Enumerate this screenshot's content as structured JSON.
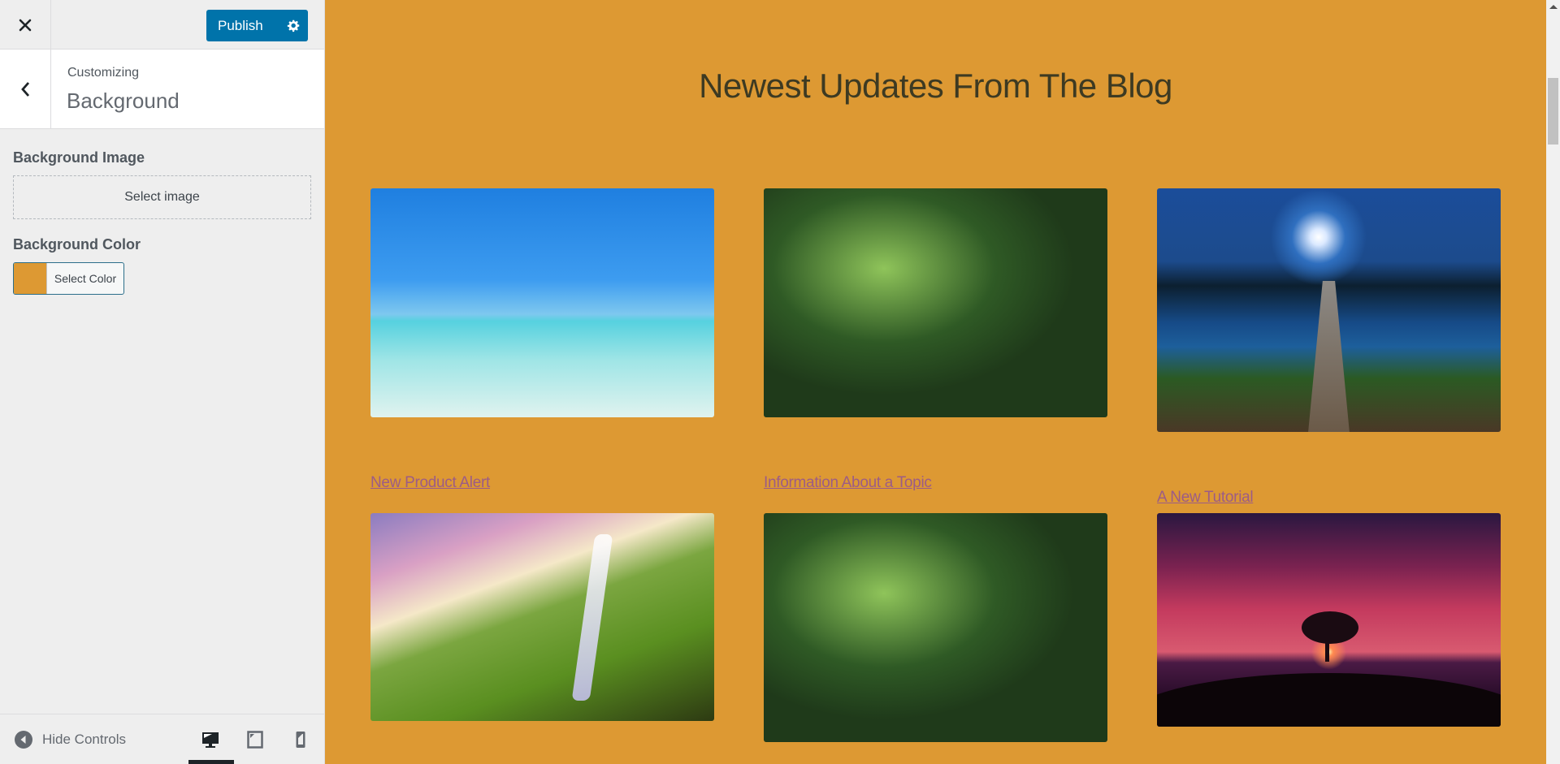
{
  "sidebar": {
    "close_icon": "close-icon",
    "publish_label": "Publish",
    "publish_settings_icon": "gear-icon",
    "back_icon": "chevron-left-icon",
    "customizing_label": "Customizing",
    "section_title": "Background",
    "background_image": {
      "title": "Background Image",
      "button_label": "Select image"
    },
    "background_color": {
      "title": "Background Color",
      "button_label": "Select Color",
      "current_color": "#dd9933"
    },
    "footer": {
      "hide_controls_label": "Hide Controls",
      "devices": [
        {
          "name": "desktop",
          "icon": "desktop-icon",
          "active": true
        },
        {
          "name": "tablet",
          "icon": "tablet-icon",
          "active": false
        },
        {
          "name": "mobile",
          "icon": "mobile-icon",
          "active": false
        }
      ]
    }
  },
  "preview": {
    "background_color": "#dd9933",
    "heading": "Newest Updates From The Blog",
    "posts": [
      {
        "image": "tropical-beach-image",
        "title": null
      },
      {
        "image": "forest-river-image",
        "title": null
      },
      {
        "image": "moonlit-lake-dock-image",
        "title": null
      }
    ],
    "links": [
      "New Product Alert",
      "Information About a Topic",
      "A New Tutorial"
    ],
    "second_row_images": [
      "waterfall-image",
      "forest-river-image",
      "sunset-tree-image"
    ]
  },
  "colors": {
    "accent": "#0073aa",
    "link": "#9c5c86",
    "sidebar_bg": "#eeeeee"
  }
}
